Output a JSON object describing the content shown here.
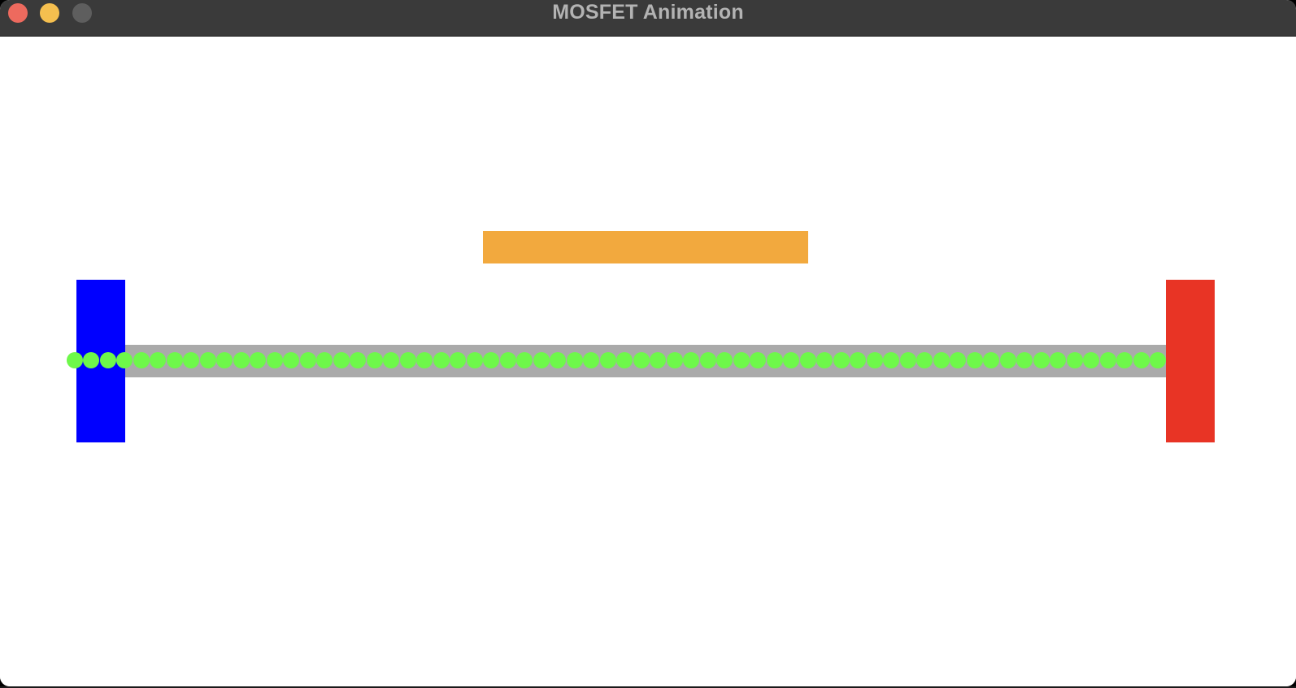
{
  "window": {
    "title": "MOSFET Animation"
  },
  "colors": {
    "titlebar": "#3a3a3a",
    "title_text": "#b3b3b3",
    "close": "#ed6a5e",
    "minimize": "#f5bf4f",
    "zoom": "#5e5e5e",
    "canvas": "#ffffff",
    "gate": "#f2a93e",
    "source": "#0000ff",
    "drain": "#e83425",
    "channel": "#aaaaaa",
    "electron": "#6ef84a"
  },
  "icons": {
    "close": "close-icon",
    "minimize": "minimize-icon",
    "zoom": "zoom-icon"
  },
  "animation": {
    "electron_count": 66
  }
}
